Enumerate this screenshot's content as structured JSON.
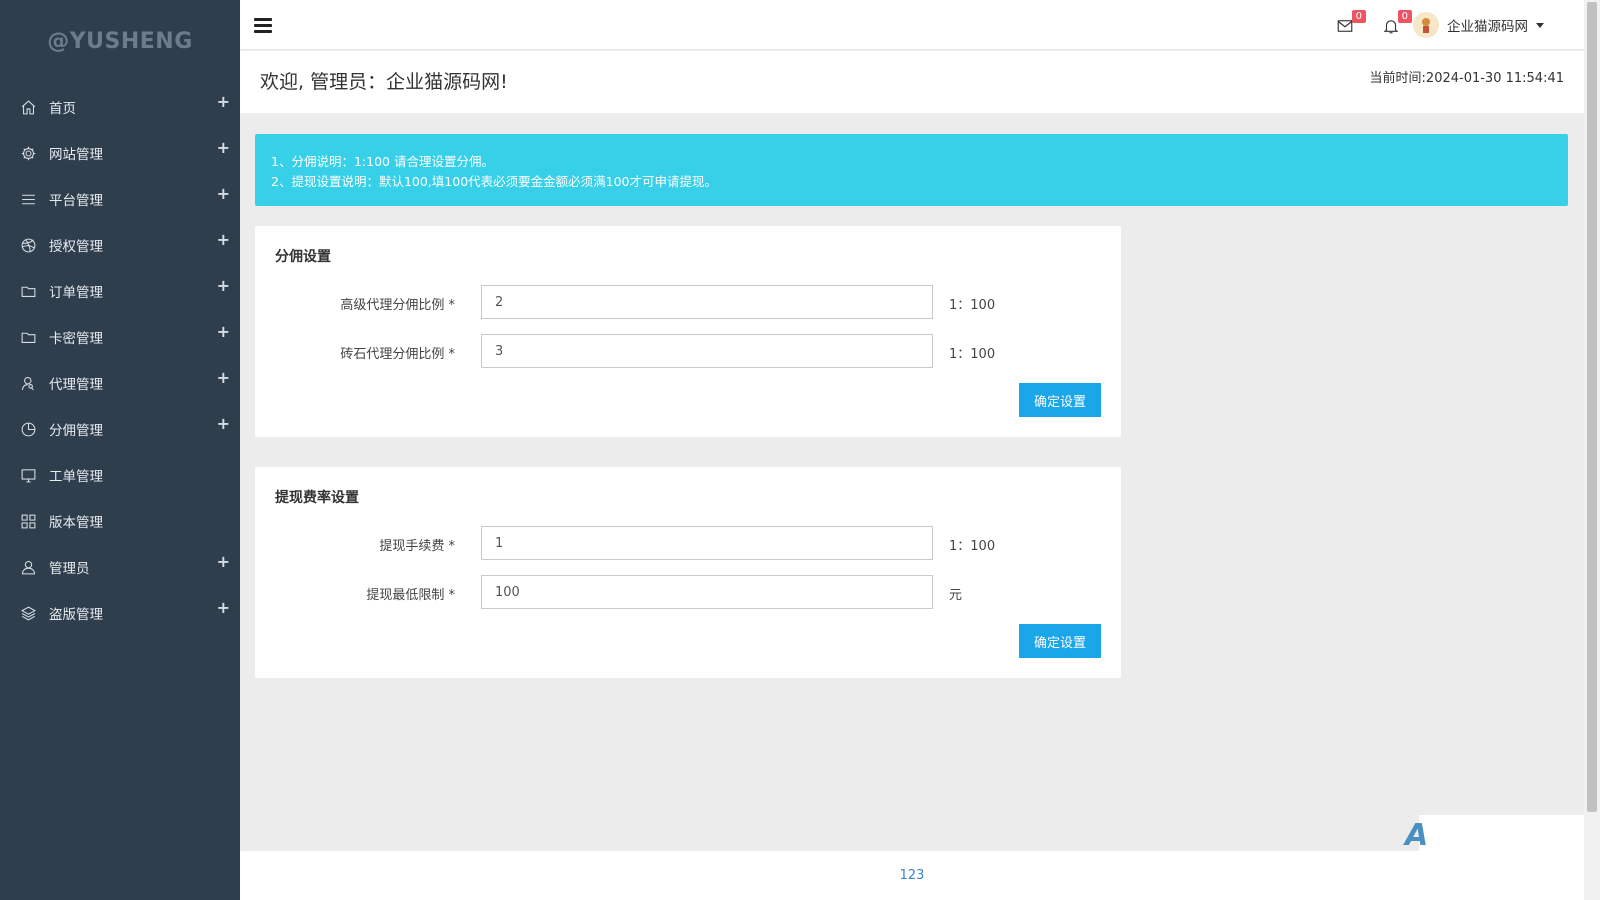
{
  "sidebar": {
    "brand": "@YUSHENG",
    "items": [
      {
        "label": "首页",
        "icon": "home-icon",
        "expand": "+"
      },
      {
        "label": "网站管理",
        "icon": "gear-icon",
        "expand": "+"
      },
      {
        "label": "平台管理",
        "icon": "list-icon",
        "expand": "+"
      },
      {
        "label": "授权管理",
        "icon": "dribbble-icon",
        "expand": "+"
      },
      {
        "label": "订单管理",
        "icon": "folder-icon",
        "expand": "+"
      },
      {
        "label": "卡密管理",
        "icon": "folder-icon",
        "expand": "+"
      },
      {
        "label": "代理管理",
        "icon": "user-search-icon",
        "expand": "+"
      },
      {
        "label": "分佣管理",
        "icon": "pie-chart-icon",
        "expand": "+"
      },
      {
        "label": "工单管理",
        "icon": "monitor-icon",
        "expand": ""
      },
      {
        "label": "版本管理",
        "icon": "grid-icon",
        "expand": ""
      },
      {
        "label": "管理员",
        "icon": "user-icon",
        "expand": "+"
      },
      {
        "label": "盗版管理",
        "icon": "layers-icon",
        "expand": "+"
      }
    ]
  },
  "header": {
    "mail_badge": "0",
    "bell_badge": "0",
    "user_name": "企业猫源码网"
  },
  "welcome": {
    "title": "欢迎, 管理员：企业猫源码网!",
    "current_time": "当前时间:2024-01-30 11:54:41"
  },
  "alert": {
    "line1": "1、分佣说明：1:100 请合理设置分佣。",
    "line2": "2、提现设置说明：默认100,填100代表必须要金金额必须满100才可申请提现。"
  },
  "commission": {
    "title": "分佣设置",
    "rows": [
      {
        "label": "高级代理分佣比例 *",
        "value": "2",
        "suffix": "1：100"
      },
      {
        "label": "砖石代理分佣比例 *",
        "value": "3",
        "suffix": "1：100"
      }
    ],
    "button": "确定设置"
  },
  "withdraw": {
    "title": "提现费率设置",
    "rows": [
      {
        "label": "提现手续费 *",
        "value": "1",
        "suffix": "1：100"
      },
      {
        "label": "提现最低限制 *",
        "value": "100",
        "suffix": "元"
      }
    ],
    "button": "确定设置"
  },
  "footer": {
    "text": "123"
  },
  "colors": {
    "sidebar_bg": "#2f3e4c",
    "alert_bg": "#37d0e8",
    "button_bg": "#1aa6e8",
    "badge_bg": "#ed5565"
  }
}
